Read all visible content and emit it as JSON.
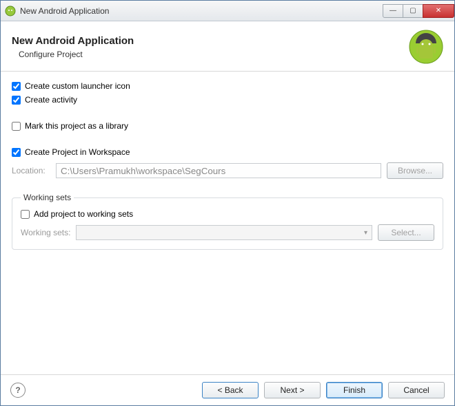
{
  "window": {
    "title": "New Android Application"
  },
  "banner": {
    "title": "New Android Application",
    "subtitle": "Configure Project"
  },
  "options": {
    "create_launcher_label": "Create custom launcher icon",
    "create_launcher_checked": true,
    "create_activity_label": "Create activity",
    "create_activity_checked": true,
    "mark_library_label": "Mark this project as a library",
    "mark_library_checked": false,
    "create_in_workspace_label": "Create Project in Workspace",
    "create_in_workspace_checked": true
  },
  "location": {
    "label": "Location:",
    "value": "C:\\Users\\Pramukh\\workspace\\SegCours",
    "browse_label": "Browse..."
  },
  "working_sets": {
    "group_label": "Working sets",
    "add_label": "Add project to working sets",
    "add_checked": false,
    "label": "Working sets:",
    "select_label": "Select..."
  },
  "footer": {
    "back": "< Back",
    "next": "Next >",
    "finish": "Finish",
    "cancel": "Cancel"
  }
}
